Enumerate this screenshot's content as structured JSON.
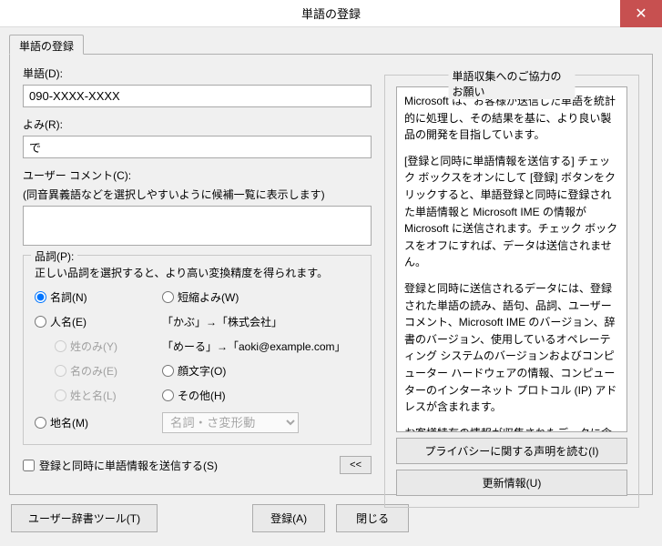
{
  "title": "単語の登録",
  "tab_label": "単語の登録",
  "word": {
    "label": "単語(D):",
    "value": "090-XXXX-XXXX"
  },
  "reading": {
    "label": "よみ(R):",
    "value": "で"
  },
  "comment": {
    "label": "ユーザー コメント(C):",
    "hint": "(同音異義語などを選択しやすいように候補一覧に表示します)"
  },
  "pos": {
    "title": "品詞(P):",
    "hint": "正しい品詞を選択すると、より高い変換精度を得られます。",
    "noun": "名詞(N)",
    "person": "人名(E)",
    "surname_only": "姓のみ(Y)",
    "given_only": "名のみ(E)",
    "full_name": "姓と名(L)",
    "place": "地名(M)",
    "abbrev": "短縮よみ(W)",
    "example1": "「かぶ」→「株式会社」",
    "example2": "「めーる」→「aoki@example.com」",
    "face": "顔文字(O)",
    "other": "その他(H)",
    "select_placeholder": "名詞・さ変形動"
  },
  "send": {
    "checkbox": "登録と同時に単語情報を送信する(S)",
    "toggle": "<<"
  },
  "info": {
    "title": "単語収集へのご協力のお願い",
    "p1": "Microsoft は、お客様が送信した単語を統計的に処理し、その結果を基に、より良い製品の開発を目指しています。",
    "p2": "[登録と同時に単語情報を送信する] チェック ボックスをオンにして [登録] ボタンをクリックすると、単語登録と同時に登録された単語情報と Microsoft IME の情報が Microsoft に送信されます。チェック ボックスをオフにすれば、データは送信されません。",
    "p3": "登録と同時に送信されるデータには、登録された単語の読み、語句、品詞、ユーザー コメント、Microsoft IME のバージョン、辞書のバージョン、使用しているオペレーティング システムのバージョンおよびコンピューター ハードウェアの情報、コンピューターのインターネット プロトコル (IP) アドレスが含まれます。",
    "p4": "お客様特有の情報が収集されたデータに含まれることがあります。このような情報が存在する場合でも、Microsoft では、お客様を特定するため",
    "privacy_btn": "プライバシーに関する声明を読む(I)",
    "update_btn": "更新情報(U)"
  },
  "footer": {
    "dict_tool": "ユーザー辞書ツール(T)",
    "register": "登録(A)",
    "close": "閉じる"
  }
}
